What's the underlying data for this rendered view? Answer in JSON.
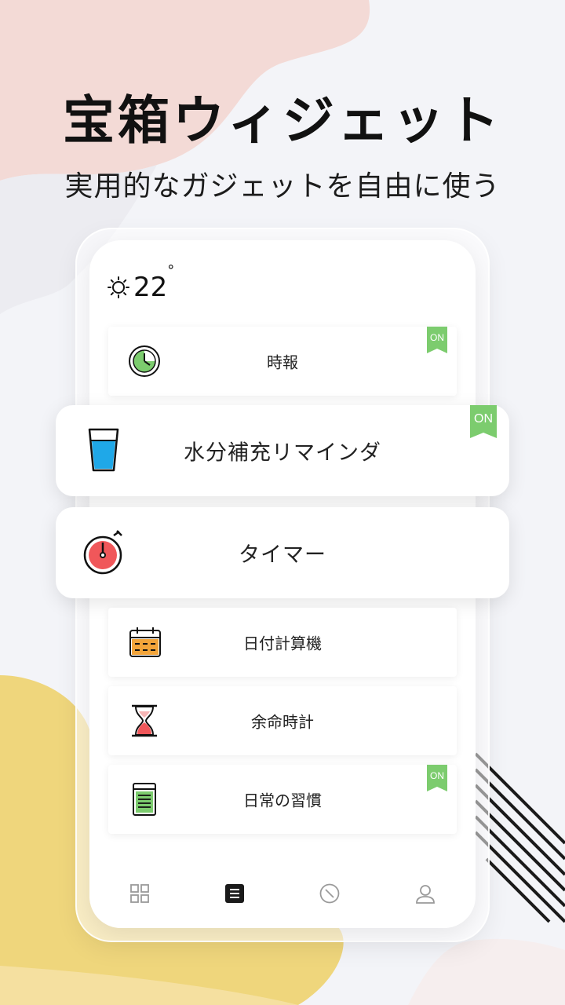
{
  "headline": "宝箱ウィジェット",
  "subheadline": "実用的なガジェットを自由に使う",
  "weather": {
    "icon": "sun-icon",
    "temperature": "22",
    "degree_symbol": "°"
  },
  "widgets": [
    {
      "label": "時報",
      "icon": "clock-icon",
      "on": true,
      "on_label": "ON"
    },
    {
      "label": "水分補充リマインダ",
      "icon": "water-glass-icon",
      "on": true,
      "on_label": "ON"
    },
    {
      "label": "タイマー",
      "icon": "stopwatch-icon",
      "on": false
    },
    {
      "label": "日付計算機",
      "icon": "calendar-icon",
      "on": false
    },
    {
      "label": "余命時計",
      "icon": "hourglass-icon",
      "on": false
    },
    {
      "label": "日常の習慣",
      "icon": "checklist-icon",
      "on": true,
      "on_label": "ON"
    }
  ],
  "bottom_nav": [
    {
      "name": "grid-icon",
      "active": false
    },
    {
      "name": "list-icon",
      "active": true
    },
    {
      "name": "compass-icon",
      "active": false
    },
    {
      "name": "profile-icon",
      "active": false
    }
  ],
  "colors": {
    "accent_green": "#7ccc6e",
    "timer_red": "#f0575a",
    "water_blue": "#1fa8e8",
    "calendar_orange": "#f2a43a",
    "blob_pink": "#f3dcd8",
    "blob_yellow": "#efd67a"
  }
}
